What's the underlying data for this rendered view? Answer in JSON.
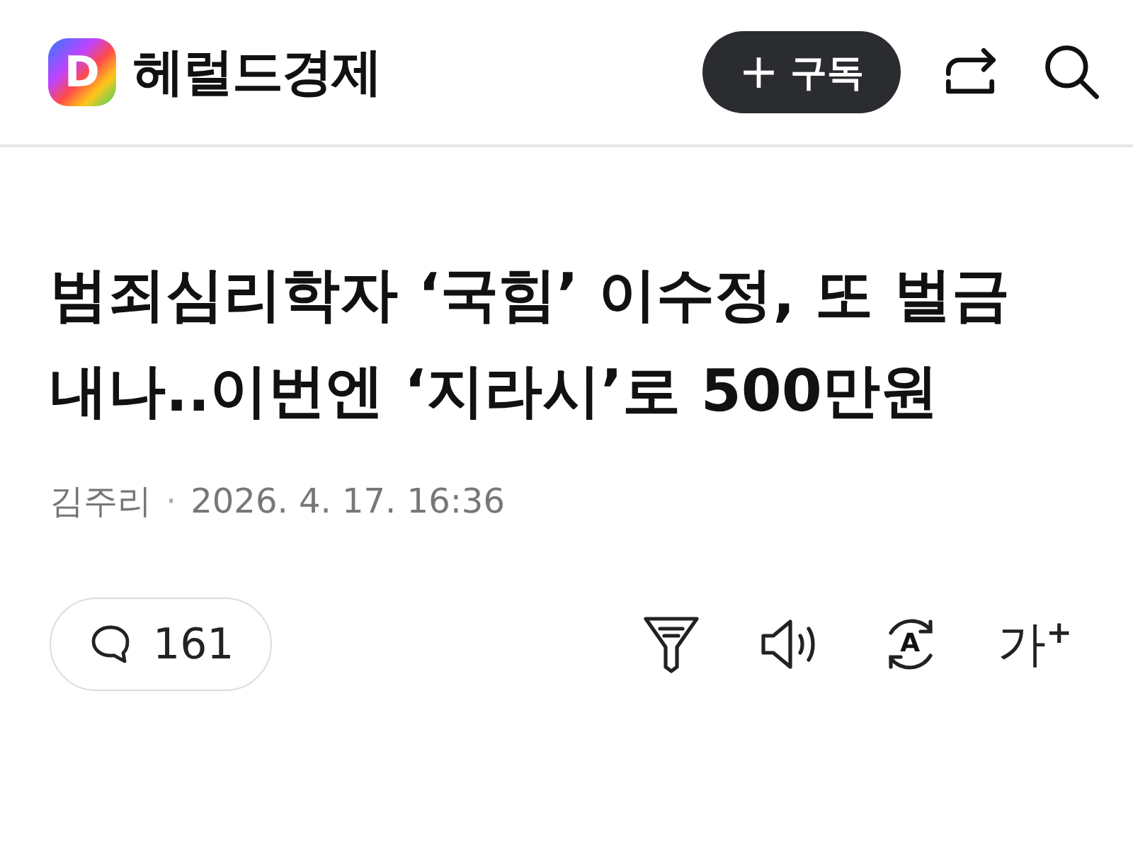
{
  "header": {
    "logo": {
      "letter": "D",
      "name": "헤럴드경제"
    },
    "subscribe_button": {
      "icon": "+",
      "label": "구독"
    }
  },
  "article": {
    "title": "범죄심리학자 ‘국힘’ 이수정, 또 벌금내나..이번엔 ‘지라시’로 500만원",
    "author": "김주리",
    "separator": "·",
    "date": "2026. 4. 17. 16:36"
  },
  "toolbar": {
    "comment_count": "161",
    "translate_letter": "A",
    "font_size": {
      "letter": "가",
      "sign": "+"
    }
  }
}
